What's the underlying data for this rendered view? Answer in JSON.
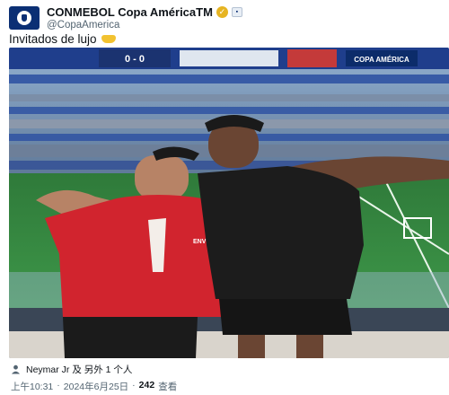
{
  "author": {
    "display_name": "CONMEBOL Copa AméricaTM",
    "handle": "@CopaAmerica",
    "avatar_icon": "copa-america-logo-icon",
    "verified_icon": "gold-verified-badge-icon",
    "affiliate_icon": "affiliate-badge-icon"
  },
  "tweet": {
    "text": "Invitados de lujo",
    "emoji_icon": "crown-emoji-icon"
  },
  "media": {
    "scoreboard_text": "0 - 0",
    "sign_text": "COPA AMÉRICA",
    "shirt_text": "ENVY"
  },
  "tags": {
    "text": "Neymar Jr 及 另外 1 个人",
    "icon": "person-tag-icon"
  },
  "meta": {
    "time": "上午10:31",
    "separator1": "·",
    "date": "2024年6月25日",
    "separator2": "·",
    "views_count": "242",
    "views_label": "查看"
  },
  "colors": {
    "brand": "#0b2f74",
    "verified_gold": "#e6b422",
    "text_primary": "#0f1419",
    "text_secondary": "#536471"
  }
}
